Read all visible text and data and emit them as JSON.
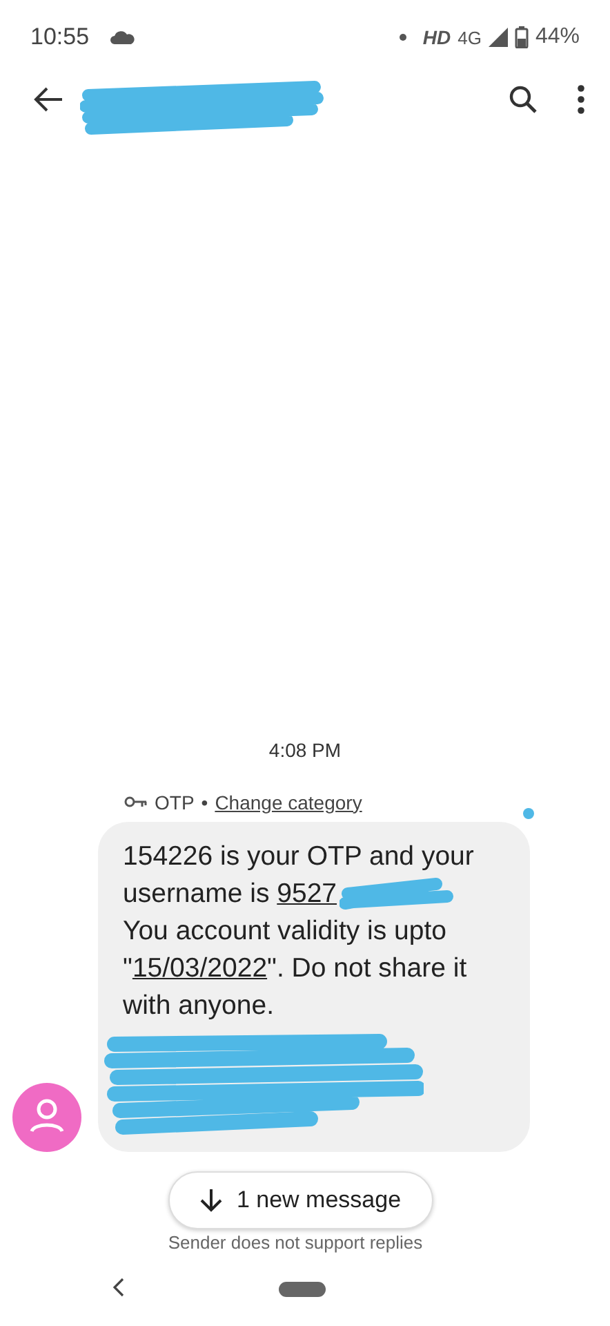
{
  "status_bar": {
    "time": "10:55",
    "network_hd": "HD",
    "network_type": "4G",
    "battery": "44%"
  },
  "message": {
    "timestamp": "4:08 PM",
    "category": "OTP",
    "separator": "•",
    "change_category": "Change category",
    "unread": true,
    "blocks": [
      {
        "segments": [
          {
            "kind": "text",
            "text": "154226 is your OTP and your"
          }
        ]
      },
      {
        "segments": [
          {
            "kind": "text",
            "text": "username is "
          },
          {
            "kind": "link",
            "text": "9527"
          }
        ],
        "redacted_after": true
      },
      {
        "segments": [
          {
            "kind": "text",
            "text": "You account validity is upto \""
          },
          {
            "kind": "link",
            "text": "15/03/2022"
          },
          {
            "kind": "text",
            "text": "\". Do not share it with anyone."
          }
        ]
      }
    ]
  },
  "new_message_button": {
    "label": "1 new message"
  },
  "footer_note": "Sender does not support replies"
}
